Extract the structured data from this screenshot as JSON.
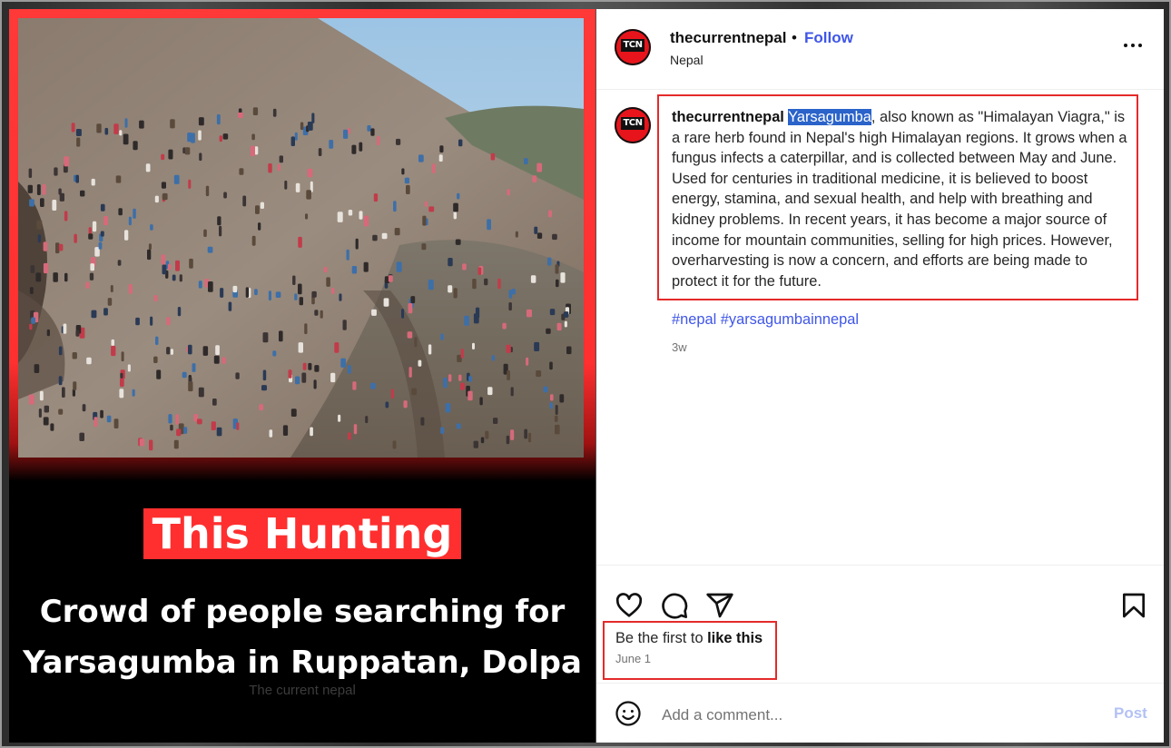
{
  "media": {
    "headline": "This Hunting",
    "subtitle_line1": "Crowd of people searching for",
    "subtitle_line2": "Yarsagumba in Ruppatan, Dolpa",
    "watermark": "The current nepal"
  },
  "post": {
    "avatar_text": "TCN",
    "username": "thecurrentnepal",
    "separator": "•",
    "follow_label": "Follow",
    "location": "Nepal",
    "caption": {
      "username": "thecurrentnepal",
      "highlighted": "Yarsagumba",
      "text": ", also known as \"Himalayan Viagra,\" is a rare herb found in Nepal's high Himalayan regions. It grows when a fungus infects a caterpillar, and is collected between May and June. Used for centuries in traditional medicine, it is believed to boost energy, stamina, and sexual health, and help with breathing and kidney problems. In recent years, it has become a major source of income for mountain communities, selling for high prices. However, overharvesting is now a concern, and efforts are being made to protect it for the future."
    },
    "hashtags": [
      "#nepal",
      "#yarsagumbainnepal"
    ],
    "age": "3w",
    "likes_prefix": "Be the first to ",
    "likes_bold": "like this",
    "date": "June 1",
    "comment_placeholder": "Add a comment...",
    "post_label": "Post"
  },
  "colors": {
    "accent_blue": "#3f56e8",
    "highlight_red": "#e52a2a",
    "selection_blue": "#2a63c9",
    "brand_red": "#ff2f2f"
  }
}
